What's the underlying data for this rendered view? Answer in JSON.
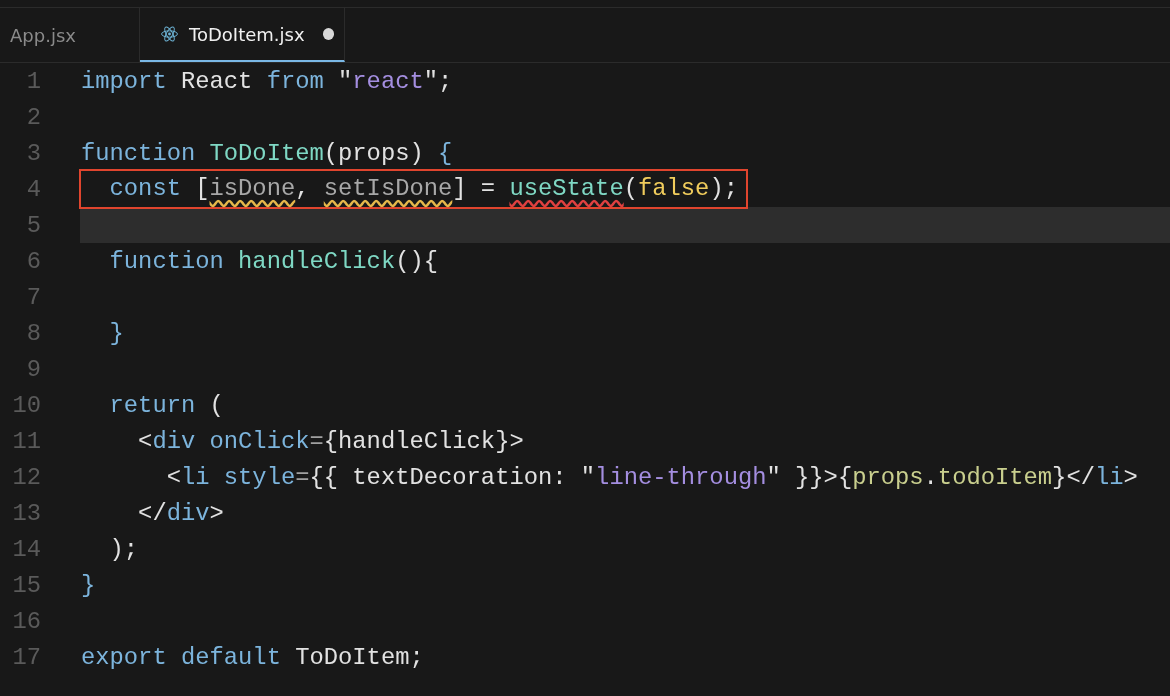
{
  "tabs": [
    {
      "label": "App.jsx",
      "selected": false,
      "modified": false,
      "icon": false
    },
    {
      "label": "ToDoItem.jsx",
      "selected": true,
      "modified": true,
      "icon": true
    }
  ],
  "editor": {
    "lines": [
      {
        "number": "1",
        "current": false,
        "boxed": false,
        "tokens": [
          {
            "text": "import",
            "kind": "keyword"
          },
          {
            "text": " React ",
            "kind": "plain"
          },
          {
            "text": "from",
            "kind": "keyword"
          },
          {
            "text": " \"",
            "kind": "plain"
          },
          {
            "text": "react",
            "kind": "string"
          },
          {
            "text": "\";",
            "kind": "plain"
          }
        ]
      },
      {
        "number": "2",
        "current": false,
        "boxed": false
      },
      {
        "number": "3",
        "current": false,
        "boxed": false,
        "tokens": [
          {
            "text": "function",
            "kind": "keyword"
          },
          {
            "text": " ToDoItem",
            "kind": "function"
          },
          {
            "text": "(props) ",
            "kind": "plain"
          },
          {
            "text": "{",
            "kind": "keyword"
          }
        ]
      },
      {
        "number": "4",
        "current": false,
        "boxed": true,
        "tokens": [
          {
            "text": "  const",
            "kind": "keyword"
          },
          {
            "text": " [",
            "kind": "plain"
          },
          {
            "text": "isDone",
            "kind": "unused"
          },
          {
            "text": ", ",
            "kind": "plain"
          },
          {
            "text": "setIsDone",
            "kind": "unused"
          },
          {
            "text": "] = ",
            "kind": "plain"
          },
          {
            "text": "useState",
            "kind": "undefined"
          },
          {
            "text": "(",
            "kind": "plain"
          },
          {
            "text": "false",
            "kind": "bool"
          },
          {
            "text": ");",
            "kind": "plain"
          }
        ]
      },
      {
        "number": "5",
        "current": true,
        "boxed": false
      },
      {
        "number": "6",
        "current": false,
        "boxed": false,
        "tokens": [
          {
            "text": "  function",
            "kind": "keyword"
          },
          {
            "text": " handleClick",
            "kind": "function"
          },
          {
            "text": "(){",
            "kind": "plain"
          }
        ]
      },
      {
        "number": "7",
        "current": false,
        "boxed": false
      },
      {
        "number": "8",
        "current": false,
        "boxed": false,
        "tokens": [
          {
            "text": "  }",
            "kind": "keyword"
          }
        ]
      },
      {
        "number": "9",
        "current": false,
        "boxed": false
      },
      {
        "number": "10",
        "current": false,
        "boxed": false,
        "tokens": [
          {
            "text": "  return",
            "kind": "keyword"
          },
          {
            "text": " (",
            "kind": "plain"
          }
        ]
      },
      {
        "number": "11",
        "current": false,
        "boxed": false,
        "tokens": [
          {
            "text": "    <",
            "kind": "plain"
          },
          {
            "text": "div",
            "kind": "keyword"
          },
          {
            "text": " onClick",
            "kind": "keyword"
          },
          {
            "text": "=",
            "kind": "dim"
          },
          {
            "text": "{handleClick}>",
            "kind": "plain"
          }
        ]
      },
      {
        "number": "12",
        "current": false,
        "boxed": false,
        "tokens": [
          {
            "text": "      <",
            "kind": "plain"
          },
          {
            "text": "li",
            "kind": "keyword"
          },
          {
            "text": " style",
            "kind": "keyword"
          },
          {
            "text": "=",
            "kind": "dim"
          },
          {
            "text": "{{ textDecoration: \"",
            "kind": "plain"
          },
          {
            "text": "line-through",
            "kind": "string"
          },
          {
            "text": "\" }}>{",
            "kind": "plain"
          },
          {
            "text": "props",
            "kind": "property"
          },
          {
            "text": ".",
            "kind": "plain"
          },
          {
            "text": "todoItem",
            "kind": "property"
          },
          {
            "text": "}</",
            "kind": "plain"
          },
          {
            "text": "li",
            "kind": "keyword"
          },
          {
            "text": ">",
            "kind": "plain"
          }
        ]
      },
      {
        "number": "13",
        "current": false,
        "boxed": false,
        "tokens": [
          {
            "text": "    </",
            "kind": "plain"
          },
          {
            "text": "div",
            "kind": "keyword"
          },
          {
            "text": ">",
            "kind": "plain"
          }
        ]
      },
      {
        "number": "14",
        "current": false,
        "boxed": false,
        "tokens": [
          {
            "text": "  );",
            "kind": "plain"
          }
        ]
      },
      {
        "number": "15",
        "current": false,
        "boxed": false,
        "tokens": [
          {
            "text": "}",
            "kind": "keyword"
          }
        ]
      },
      {
        "number": "16",
        "current": false,
        "boxed": false
      },
      {
        "number": "17",
        "current": false,
        "boxed": false,
        "tokens": [
          {
            "text": "export",
            "kind": "keyword"
          },
          {
            "text": " default",
            "kind": "keyword"
          },
          {
            "text": " ToDoItem;",
            "kind": "plain"
          }
        ]
      }
    ]
  }
}
